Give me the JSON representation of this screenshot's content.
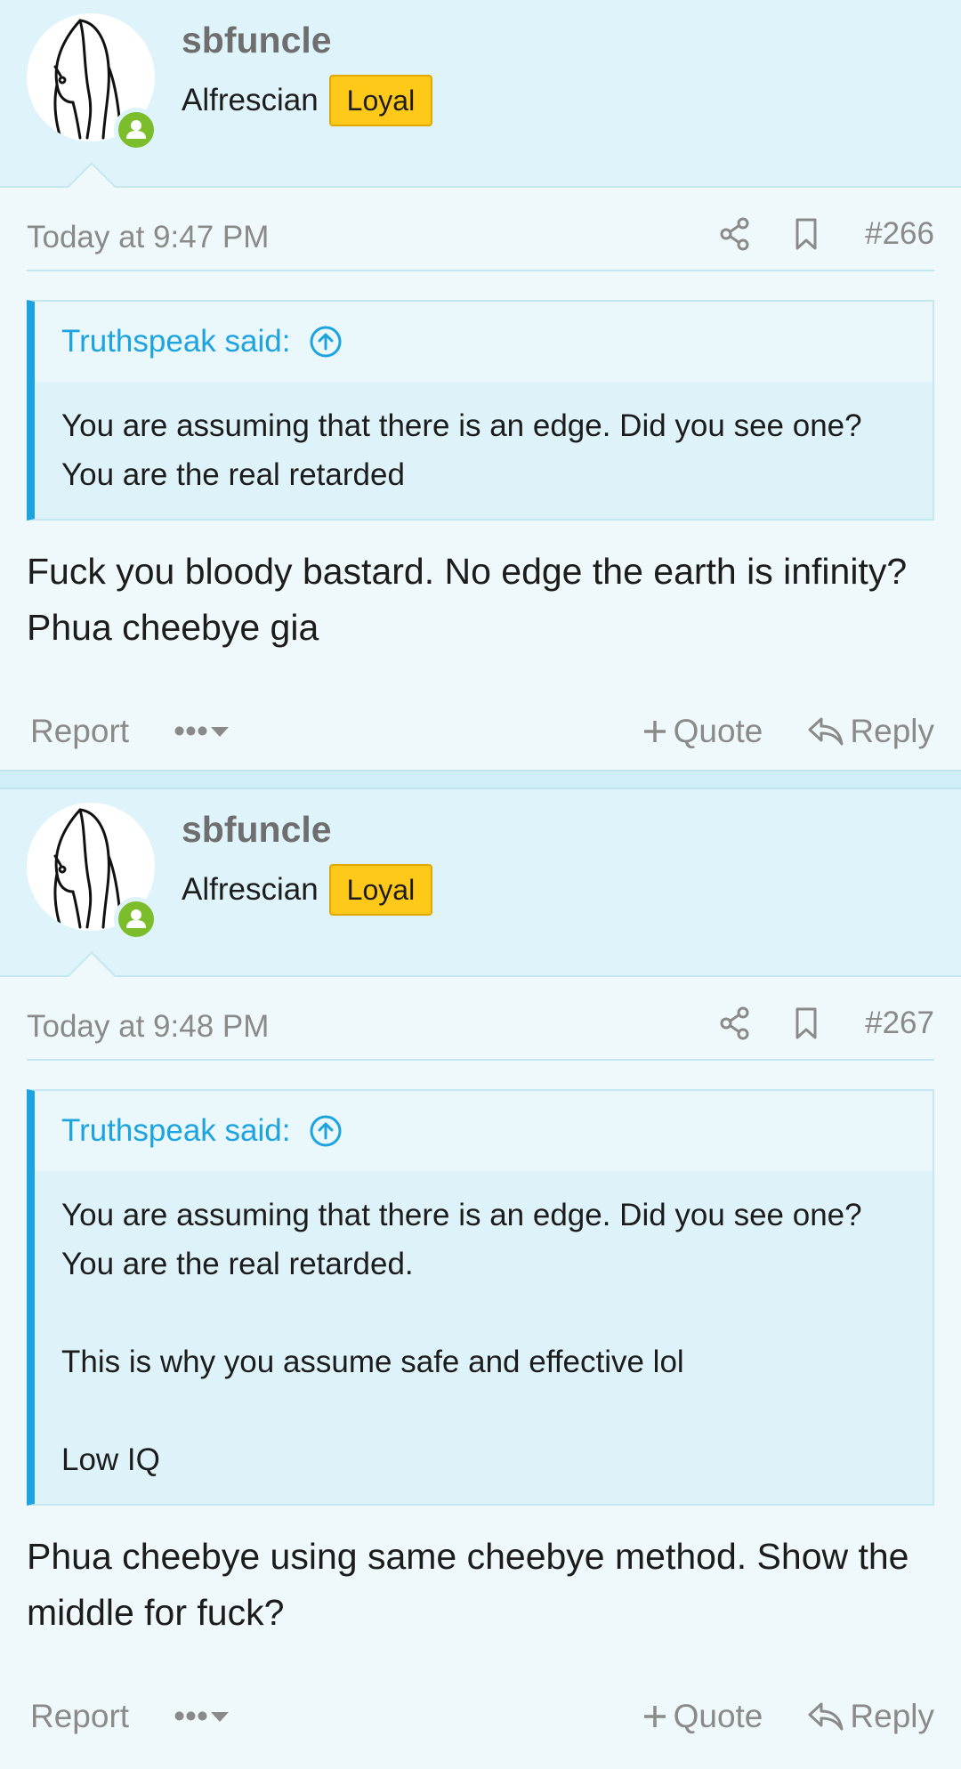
{
  "colors": {
    "page_bg": "#eff9fc",
    "header_bg": "#dff4fa",
    "accent_blue": "#1da3e0",
    "banner_yellow": "#ffc919",
    "online_green": "#7cbd2c",
    "muted_text": "#8a8a8a"
  },
  "posts": [
    {
      "author": "sbfuncle",
      "user_title": "Alfrescian",
      "user_banner": "Loyal",
      "avatar_icon": "avatar-sketch-icon",
      "online_icon": "online-status-icon",
      "date": "Today at 9:47 PM",
      "share_icon": "share-icon",
      "bookmark_icon": "bookmark-icon",
      "number": "#266",
      "quote_author": "Truthspeak said:",
      "quote_lines": [
        "You are assuming that there is an edge. Did you see one? You are the real retarded"
      ],
      "message": "Fuck you bloody bastard. No edge the earth is infinity? Phua cheebye gia",
      "actions": {
        "report": "Report",
        "more": "•••",
        "quote": "Quote",
        "reply": "Reply"
      }
    },
    {
      "author": "sbfuncle",
      "user_title": "Alfrescian",
      "user_banner": "Loyal",
      "avatar_icon": "avatar-sketch-icon",
      "online_icon": "online-status-icon",
      "date": "Today at 9:48 PM",
      "share_icon": "share-icon",
      "bookmark_icon": "bookmark-icon",
      "number": "#267",
      "quote_author": "Truthspeak said:",
      "quote_lines": [
        "You are assuming that there is an edge. Did you see one? You are the real retarded.",
        "",
        "This is why you assume safe and effective lol",
        "",
        "Low IQ"
      ],
      "message": "Phua cheebye using same cheebye method. Show the middle for fuck?",
      "actions": {
        "report": "Report",
        "more": "•••",
        "quote": "Quote",
        "reply": "Reply"
      }
    }
  ]
}
